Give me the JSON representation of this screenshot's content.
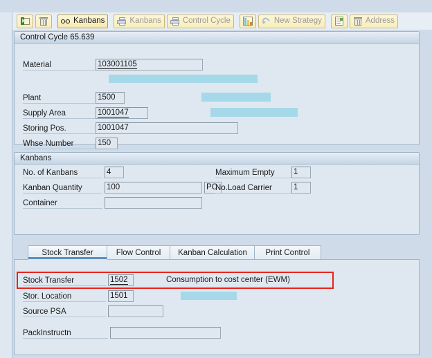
{
  "toolbar": {
    "buttons": [
      {
        "name": "open-folder-button",
        "icon": "folder-open-icon",
        "label": "",
        "active": false
      },
      {
        "name": "delete-button",
        "icon": "trash-icon",
        "label": "",
        "active": false
      },
      {
        "name": "kanbans-glasses-button",
        "icon": "glasses-icon",
        "label": "Kanbans",
        "active": true
      },
      {
        "name": "print-kanbans-button",
        "icon": "printer-icon",
        "label": "Kanbans",
        "active": false
      },
      {
        "name": "print-control-cycle-button",
        "icon": "printer-icon",
        "label": "Control Cycle",
        "active": false
      },
      {
        "name": "chart-button",
        "icon": "bar-chart-icon",
        "label": "",
        "active": false
      },
      {
        "name": "new-strategy-button",
        "icon": "undo-arrow-icon",
        "label": "New Strategy",
        "active": false
      },
      {
        "name": "details-list-button",
        "icon": "list-icon",
        "label": "",
        "active": false
      },
      {
        "name": "address-button",
        "icon": "trash-icon",
        "label": "Address",
        "active": false
      }
    ]
  },
  "control_cycle": {
    "title": "Control Cycle 65.639",
    "fields": {
      "material_label": "Material",
      "material_value": "103001105",
      "plant_label": "Plant",
      "plant_value": "1500",
      "supply_area_label": "Supply Area",
      "supply_area_value": "1001047",
      "storing_pos_label": "Storing Pos.",
      "storing_pos_value": "1001047",
      "whse_number_label": "Whse Number",
      "whse_number_value": "150"
    }
  },
  "kanbans": {
    "title": "Kanbans",
    "fields": {
      "no_of_kanbans_label": "No. of Kanbans",
      "no_of_kanbans_value": "4",
      "kanban_quantity_label": "Kanban Quantity",
      "kanban_quantity_value": "100",
      "kanban_quantity_uom": "PC",
      "container_label": "Container",
      "container_value": "",
      "maximum_empty_label": "Maximum Empty",
      "maximum_empty_value": "1",
      "no_load_carrier_label": "No.Load Carrier",
      "no_load_carrier_value": "1"
    }
  },
  "tabs": [
    {
      "label": "Stock Transfer",
      "selected": true
    },
    {
      "label": "Flow Control",
      "selected": false
    },
    {
      "label": "Kanban Calculation",
      "selected": false
    },
    {
      "label": "Print Control",
      "selected": false
    }
  ],
  "stock_transfer": {
    "stock_transfer_label": "Stock Transfer",
    "stock_transfer_value": "1502",
    "stock_transfer_desc": "Consumption to cost center (EWM)",
    "stor_location_label": "Stor. Location",
    "stor_location_value": "1501",
    "source_psa_label": "Source PSA",
    "source_psa_value": "",
    "pack_instructn_label": "PackInstructn",
    "pack_instructn_value": ""
  },
  "colors": {
    "window_bg": "#dfe8f0",
    "panel_border": "#9fb4c9",
    "redaction": "#a5d8e8",
    "highlight_box": "#e8241c",
    "tab_accent": "#5b8ebf",
    "toolbar_button": "#f8eeba"
  }
}
